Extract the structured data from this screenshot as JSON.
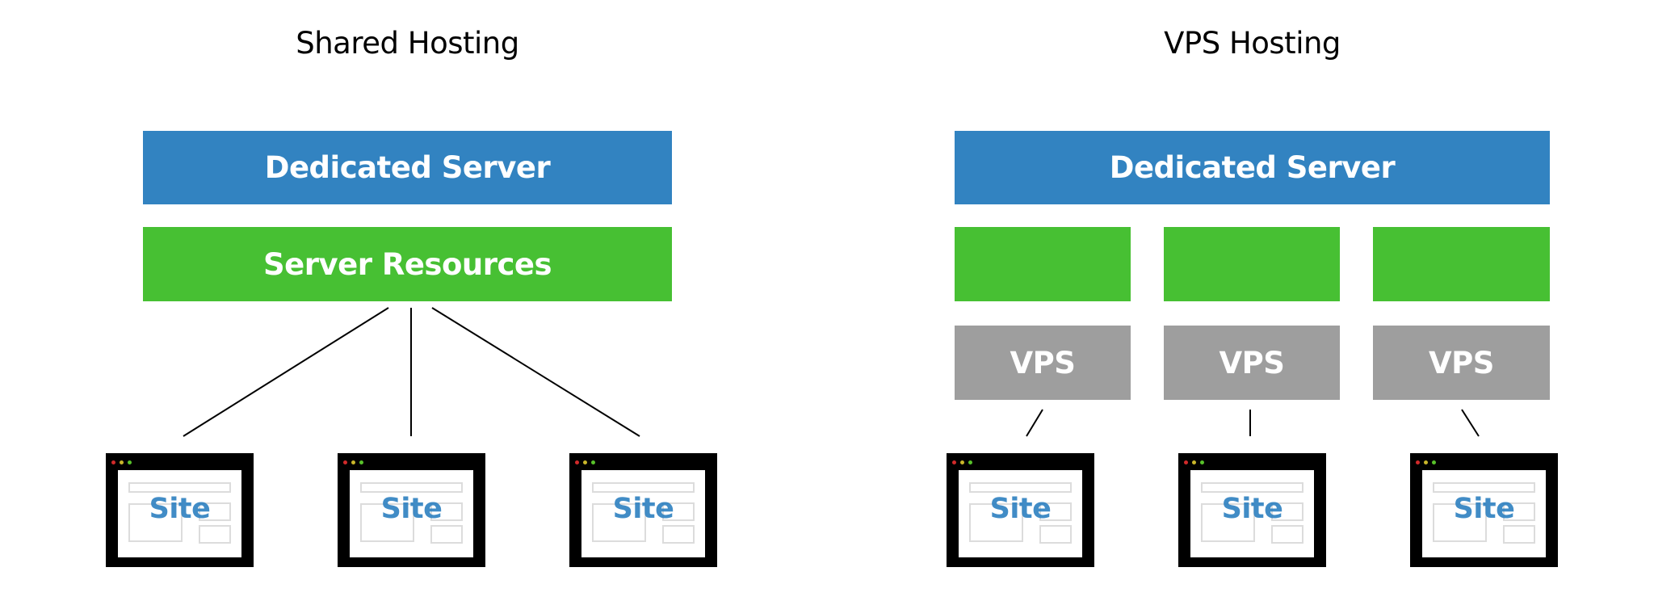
{
  "colors": {
    "server": "#3283c1",
    "resources": "#47c033",
    "vps": "#9e9e9e",
    "site_text": "#2c7fc0",
    "window_frame": "#000000"
  },
  "shared": {
    "title": "Shared Hosting",
    "server_label": "Dedicated Server",
    "resources_label": "Server Resources",
    "sites": [
      {
        "label": "Site"
      },
      {
        "label": "Site"
      },
      {
        "label": "Site"
      }
    ]
  },
  "vps": {
    "title": "VPS Hosting",
    "server_label": "Dedicated Server",
    "resources": [
      {
        "label": ""
      },
      {
        "label": ""
      },
      {
        "label": ""
      }
    ],
    "containers": [
      {
        "label": "VPS"
      },
      {
        "label": "VPS"
      },
      {
        "label": "VPS"
      }
    ],
    "sites": [
      {
        "label": "Site"
      },
      {
        "label": "Site"
      },
      {
        "label": "Site"
      }
    ]
  }
}
